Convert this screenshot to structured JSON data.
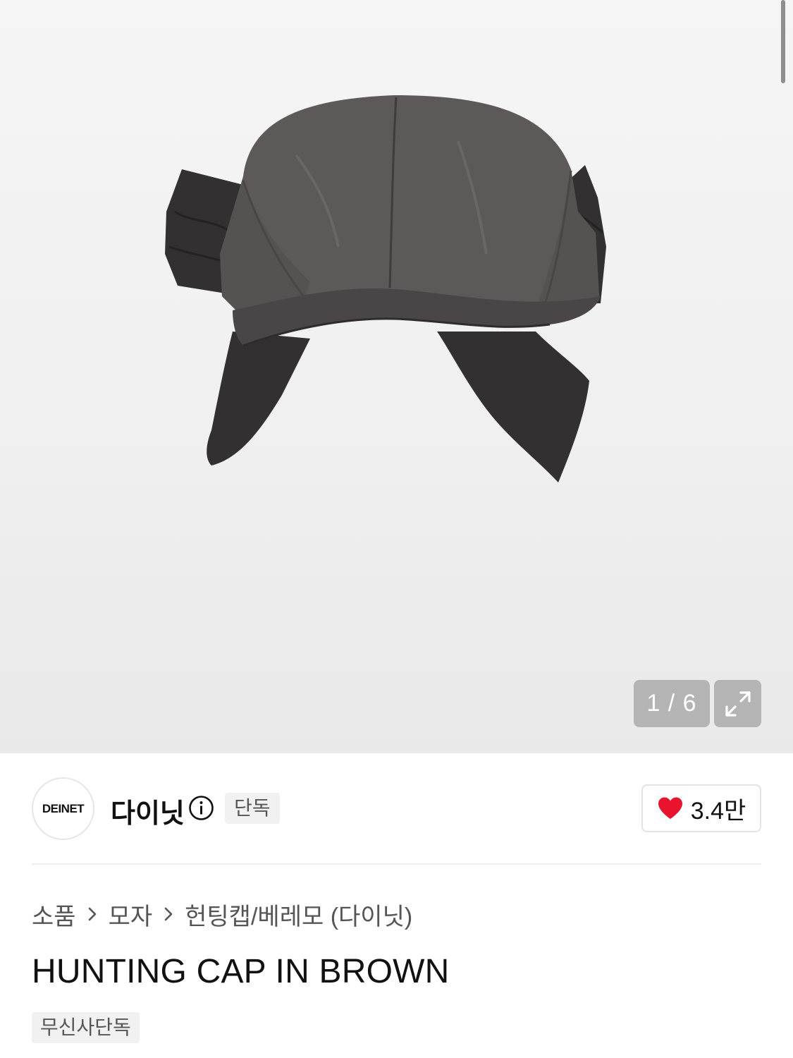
{
  "gallery": {
    "counter": "1 / 6",
    "image_label": "product-photo"
  },
  "brand": {
    "logo_text": "DEINET",
    "name": "다이닛",
    "exclusive_label": "단독",
    "likes": "3.4만"
  },
  "breadcrumb": {
    "items": [
      "소품",
      "모자",
      "헌팅캡/베레모 (다이닛)"
    ]
  },
  "product": {
    "title": "HUNTING CAP IN BROWN",
    "tag": "무신사단독"
  },
  "icons": {
    "expand": "expand-icon",
    "info": "info-icon",
    "heart": "heart-icon",
    "chevron": "chevron-right-icon"
  },
  "colors": {
    "heart": "#e8142d",
    "cap_main": "#5c5858",
    "cap_dark": "#353233"
  }
}
